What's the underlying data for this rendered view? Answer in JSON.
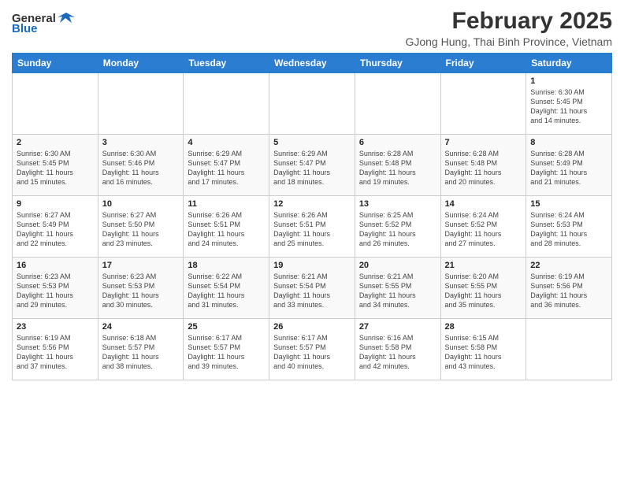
{
  "header": {
    "logo_general": "General",
    "logo_blue": "Blue",
    "month_year": "February 2025",
    "location": "GJong Hung, Thai Binh Province, Vietnam"
  },
  "weekdays": [
    "Sunday",
    "Monday",
    "Tuesday",
    "Wednesday",
    "Thursday",
    "Friday",
    "Saturday"
  ],
  "weeks": [
    [
      {
        "day": "",
        "text": ""
      },
      {
        "day": "",
        "text": ""
      },
      {
        "day": "",
        "text": ""
      },
      {
        "day": "",
        "text": ""
      },
      {
        "day": "",
        "text": ""
      },
      {
        "day": "",
        "text": ""
      },
      {
        "day": "1",
        "text": "Sunrise: 6:30 AM\nSunset: 5:45 PM\nDaylight: 11 hours\nand 14 minutes."
      }
    ],
    [
      {
        "day": "2",
        "text": "Sunrise: 6:30 AM\nSunset: 5:45 PM\nDaylight: 11 hours\nand 15 minutes."
      },
      {
        "day": "3",
        "text": "Sunrise: 6:30 AM\nSunset: 5:46 PM\nDaylight: 11 hours\nand 16 minutes."
      },
      {
        "day": "4",
        "text": "Sunrise: 6:29 AM\nSunset: 5:47 PM\nDaylight: 11 hours\nand 17 minutes."
      },
      {
        "day": "5",
        "text": "Sunrise: 6:29 AM\nSunset: 5:47 PM\nDaylight: 11 hours\nand 18 minutes."
      },
      {
        "day": "6",
        "text": "Sunrise: 6:28 AM\nSunset: 5:48 PM\nDaylight: 11 hours\nand 19 minutes."
      },
      {
        "day": "7",
        "text": "Sunrise: 6:28 AM\nSunset: 5:48 PM\nDaylight: 11 hours\nand 20 minutes."
      },
      {
        "day": "8",
        "text": "Sunrise: 6:28 AM\nSunset: 5:49 PM\nDaylight: 11 hours\nand 21 minutes."
      }
    ],
    [
      {
        "day": "9",
        "text": "Sunrise: 6:27 AM\nSunset: 5:49 PM\nDaylight: 11 hours\nand 22 minutes."
      },
      {
        "day": "10",
        "text": "Sunrise: 6:27 AM\nSunset: 5:50 PM\nDaylight: 11 hours\nand 23 minutes."
      },
      {
        "day": "11",
        "text": "Sunrise: 6:26 AM\nSunset: 5:51 PM\nDaylight: 11 hours\nand 24 minutes."
      },
      {
        "day": "12",
        "text": "Sunrise: 6:26 AM\nSunset: 5:51 PM\nDaylight: 11 hours\nand 25 minutes."
      },
      {
        "day": "13",
        "text": "Sunrise: 6:25 AM\nSunset: 5:52 PM\nDaylight: 11 hours\nand 26 minutes."
      },
      {
        "day": "14",
        "text": "Sunrise: 6:24 AM\nSunset: 5:52 PM\nDaylight: 11 hours\nand 27 minutes."
      },
      {
        "day": "15",
        "text": "Sunrise: 6:24 AM\nSunset: 5:53 PM\nDaylight: 11 hours\nand 28 minutes."
      }
    ],
    [
      {
        "day": "16",
        "text": "Sunrise: 6:23 AM\nSunset: 5:53 PM\nDaylight: 11 hours\nand 29 minutes."
      },
      {
        "day": "17",
        "text": "Sunrise: 6:23 AM\nSunset: 5:53 PM\nDaylight: 11 hours\nand 30 minutes."
      },
      {
        "day": "18",
        "text": "Sunrise: 6:22 AM\nSunset: 5:54 PM\nDaylight: 11 hours\nand 31 minutes."
      },
      {
        "day": "19",
        "text": "Sunrise: 6:21 AM\nSunset: 5:54 PM\nDaylight: 11 hours\nand 33 minutes."
      },
      {
        "day": "20",
        "text": "Sunrise: 6:21 AM\nSunset: 5:55 PM\nDaylight: 11 hours\nand 34 minutes."
      },
      {
        "day": "21",
        "text": "Sunrise: 6:20 AM\nSunset: 5:55 PM\nDaylight: 11 hours\nand 35 minutes."
      },
      {
        "day": "22",
        "text": "Sunrise: 6:19 AM\nSunset: 5:56 PM\nDaylight: 11 hours\nand 36 minutes."
      }
    ],
    [
      {
        "day": "23",
        "text": "Sunrise: 6:19 AM\nSunset: 5:56 PM\nDaylight: 11 hours\nand 37 minutes."
      },
      {
        "day": "24",
        "text": "Sunrise: 6:18 AM\nSunset: 5:57 PM\nDaylight: 11 hours\nand 38 minutes."
      },
      {
        "day": "25",
        "text": "Sunrise: 6:17 AM\nSunset: 5:57 PM\nDaylight: 11 hours\nand 39 minutes."
      },
      {
        "day": "26",
        "text": "Sunrise: 6:17 AM\nSunset: 5:57 PM\nDaylight: 11 hours\nand 40 minutes."
      },
      {
        "day": "27",
        "text": "Sunrise: 6:16 AM\nSunset: 5:58 PM\nDaylight: 11 hours\nand 42 minutes."
      },
      {
        "day": "28",
        "text": "Sunrise: 6:15 AM\nSunset: 5:58 PM\nDaylight: 11 hours\nand 43 minutes."
      },
      {
        "day": "",
        "text": ""
      }
    ]
  ]
}
